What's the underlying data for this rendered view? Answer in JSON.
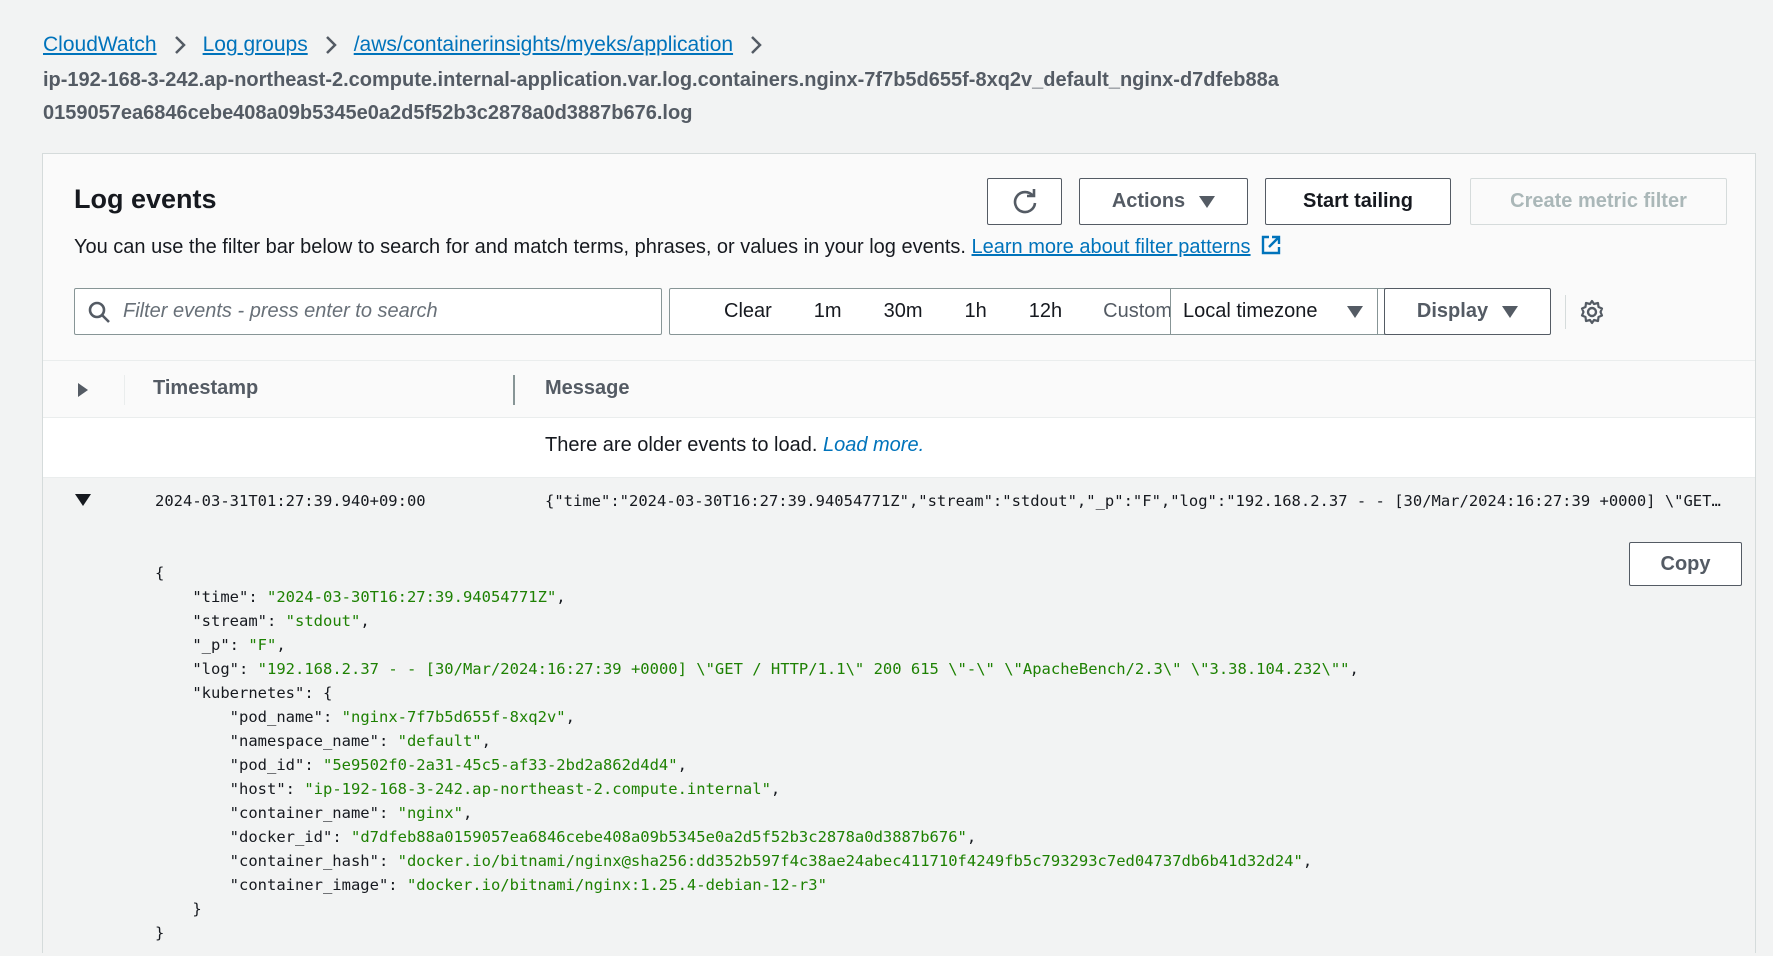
{
  "breadcrumbs": {
    "items": [
      "CloudWatch",
      "Log groups",
      "/aws/containerinsights/myeks/application"
    ],
    "current": "ip-192-168-3-242.ap-northeast-2.compute.internal-application.var.log.containers.nginx-7f7b5d655f-8xq2v_default_nginx-d7dfeb88a0159057ea6846cebe408a09b5345e0a2d5f52b3c2878a0d3887b676.log"
  },
  "panel": {
    "title": "Log events",
    "description": "You can use the filter bar below to search for and match terms, phrases, or values in your log events.",
    "learn_more": "Learn more about filter patterns",
    "buttons": {
      "actions": "Actions",
      "start_tailing": "Start tailing",
      "create_metric_filter": "Create metric filter",
      "display": "Display"
    },
    "filter": {
      "placeholder": "Filter events - press enter to search",
      "clear": "Clear",
      "ranges": [
        "1m",
        "30m",
        "1h",
        "12h"
      ],
      "custom": "Custom",
      "timezone": "Local timezone"
    }
  },
  "table": {
    "headers": {
      "timestamp": "Timestamp",
      "message": "Message"
    },
    "older_events_text": "There are older events to load.",
    "load_more": "Load more."
  },
  "event": {
    "timestamp": "2024-03-31T01:27:39.940+09:00",
    "message": "{\"time\":\"2024-03-30T16:27:39.94054771Z\",\"stream\":\"stdout\",\"_p\":\"F\",\"log\":\"192.168.2.37 - - [30/Mar/2024:16:27:39 +0000] \\\"GET / HTTP/1.1\\\" 200 615 \\\"-\\\" \\\"ApacheBench/2.3\\\" \\\"3.38.104.232\\\"\"",
    "copy_label": "Copy",
    "json": {
      "time": "\"2024-03-30T16:27:39.94054771Z\"",
      "stream": "\"stdout\"",
      "_p": "\"F\"",
      "log": "\"192.168.2.37 - - [30/Mar/2024:16:27:39 +0000] \\\"GET / HTTP/1.1\\\" 200 615 \\\"-\\\" \\\"ApacheBench/2.3\\\" \\\"3.38.104.232\\\"\"",
      "kubernetes": {
        "pod_name": "\"nginx-7f7b5d655f-8xq2v\"",
        "namespace_name": "\"default\"",
        "pod_id": "\"5e9502f0-2a31-45c5-af33-2bd2a862d4d4\"",
        "host": "\"ip-192-168-3-242.ap-northeast-2.compute.internal\"",
        "container_name": "\"nginx\"",
        "docker_id": "\"d7dfeb88a0159057ea6846cebe408a09b5345e0a2d5f52b3c2878a0d3887b676\"",
        "container_hash": "\"docker.io/bitnami/nginx@sha256:dd352b597f4c38ae24abec411710f4249fb5c793293c7ed04737db6b41d32d24\"",
        "container_image": "\"docker.io/bitnami/nginx:1.25.4-debian-12-r3\""
      }
    }
  }
}
